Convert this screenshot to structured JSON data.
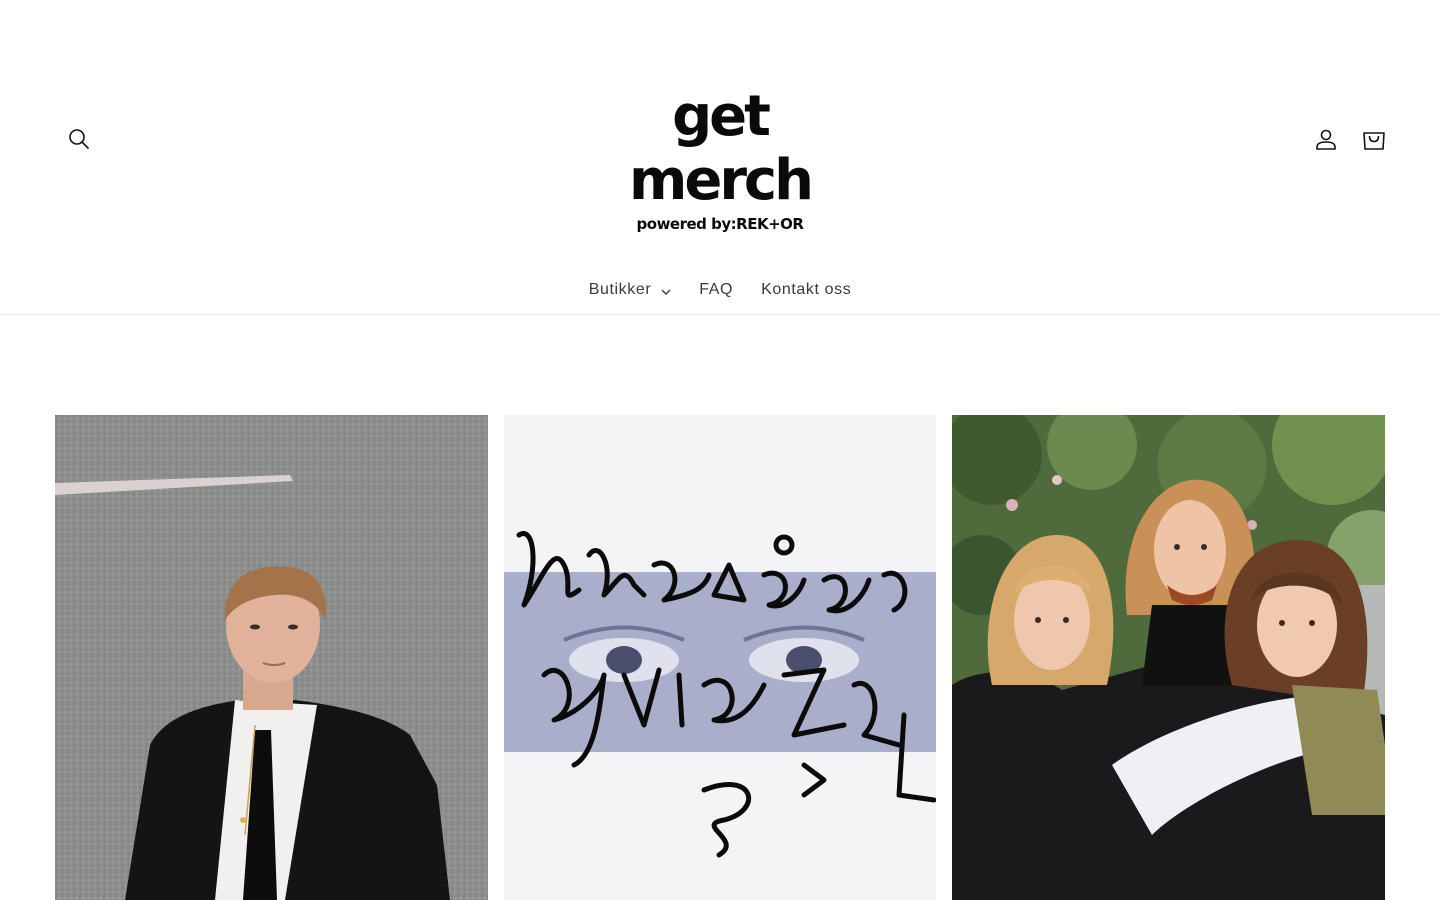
{
  "header": {
    "logo": {
      "main": "get merch",
      "sub": "powered by:REK+OR"
    },
    "icons": {
      "search": "search-icon",
      "account": "user-icon",
      "cart": "shopping-bag-icon"
    }
  },
  "nav": {
    "items": [
      {
        "label": "Butikker",
        "has_dropdown": true
      },
      {
        "label": "FAQ",
        "has_dropdown": false
      },
      {
        "label": "Kontakt oss",
        "has_dropdown": false
      }
    ]
  },
  "collections": [
    {
      "image": "artist-portrait-on-asphalt"
    },
    {
      "image": "handwritten-lettering-over-eyes-album-art"
    },
    {
      "image": "three-women-band-portrait-outdoors"
    }
  ],
  "colors": {
    "text": "#121212",
    "nav_text": "#3a3a3a",
    "border": "#e6e6e6",
    "background": "#ffffff"
  }
}
